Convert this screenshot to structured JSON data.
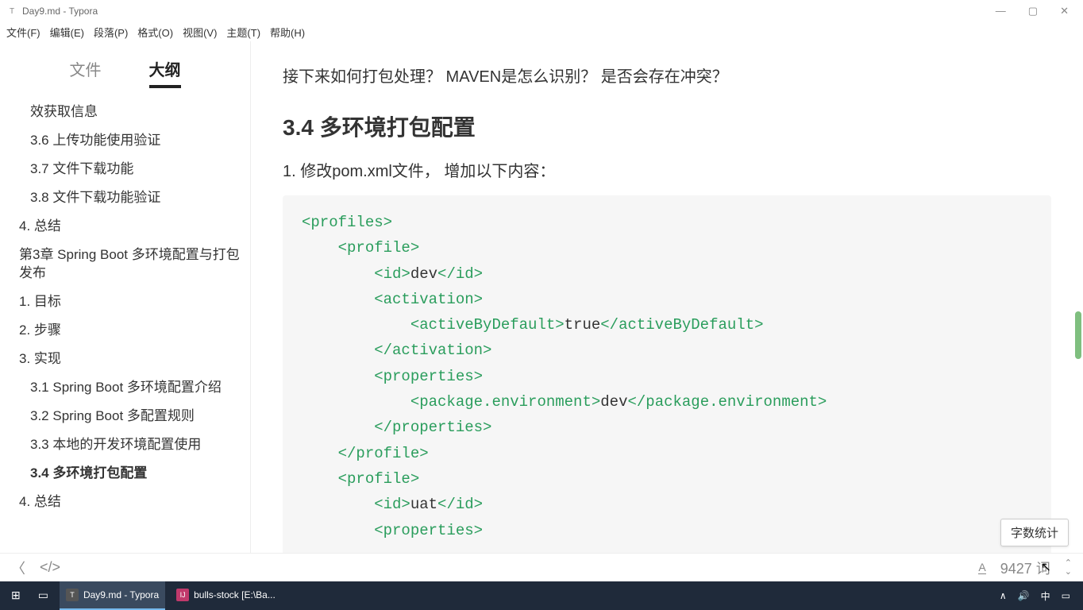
{
  "window": {
    "title": "Day9.md - Typora",
    "controls": {
      "min": "—",
      "max": "▢",
      "close": "✕"
    }
  },
  "menu": [
    "文件(F)",
    "编辑(E)",
    "段落(P)",
    "格式(O)",
    "视图(V)",
    "主题(T)",
    "帮助(H)"
  ],
  "sidebar": {
    "tabs": {
      "files": "文件",
      "outline": "大纲"
    },
    "outline": [
      {
        "label": "效获取信息",
        "indent": 2
      },
      {
        "label": "3.6 上传功能使用验证",
        "indent": 2
      },
      {
        "label": "3.7 文件下载功能",
        "indent": 2
      },
      {
        "label": "3.8 文件下载功能验证",
        "indent": 2
      },
      {
        "label": "4. 总结",
        "indent": 1
      },
      {
        "label": "第3章 Spring Boot 多环境配置与打包发布",
        "indent": 1
      },
      {
        "label": "1. 目标",
        "indent": 1
      },
      {
        "label": "2. 步骤",
        "indent": 1
      },
      {
        "label": "3. 实现",
        "indent": 1
      },
      {
        "label": "3.1 Spring Boot 多环境配置介绍",
        "indent": 2
      },
      {
        "label": "3.2 Spring Boot 多配置规则",
        "indent": 2
      },
      {
        "label": "3.3 本地的开发环境配置使用",
        "indent": 2
      },
      {
        "label": "3.4 多环境打包配置",
        "indent": 2,
        "active": true
      },
      {
        "label": "4. 总结",
        "indent": 1
      }
    ]
  },
  "content": {
    "intro": "接下来如何打包处理？  MAVEN是怎么识别？  是否会存在冲突？",
    "heading": "3.4 多环境打包配置",
    "list1": "1. 修改pom.xml文件， 增加以下内容：",
    "code": [
      {
        "t": "tag",
        "v": "<profiles>"
      },
      {
        "t": "tag",
        "v": "    <profile>"
      },
      {
        "t": "mix",
        "pre": "        <id>",
        "mid": "dev",
        "post": "</id>"
      },
      {
        "t": "tag",
        "v": "        <activation>"
      },
      {
        "t": "mix",
        "pre": "            <activeByDefault>",
        "mid": "true",
        "post": "</activeByDefault>"
      },
      {
        "t": "tag",
        "v": "        </activation>"
      },
      {
        "t": "tag",
        "v": "        <properties>"
      },
      {
        "t": "mix",
        "pre": "            <package.environment>",
        "mid": "dev",
        "post": "</package.environment>"
      },
      {
        "t": "tag",
        "v": "        </properties>"
      },
      {
        "t": "tag",
        "v": "    </profile>"
      },
      {
        "t": "tag",
        "v": "    <profile>"
      },
      {
        "t": "mix",
        "pre": "        <id>",
        "mid": "uat",
        "post": "</id>"
      },
      {
        "t": "tag",
        "v": "        <properties>"
      }
    ]
  },
  "statusbar": {
    "back": "〈",
    "code": "</>",
    "font": "A",
    "words": "9427 词",
    "updown": "⌃⌄"
  },
  "tooltip": "字数统计",
  "taskbar": {
    "items": [
      {
        "icon": "⊞",
        "label": ""
      },
      {
        "icon": "▭",
        "label": ""
      },
      {
        "icon": "T",
        "label": "Day9.md - Typora",
        "active": true
      },
      {
        "icon": "IJ",
        "label": "bulls-stock [E:\\Ba..."
      }
    ],
    "right": [
      "∧",
      "🔊",
      "中",
      "▭"
    ]
  }
}
